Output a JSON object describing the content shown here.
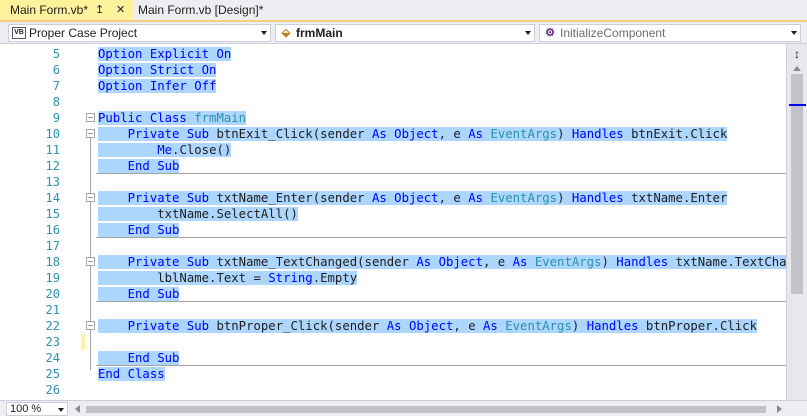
{
  "tabs": [
    {
      "label": "Main Form.vb*",
      "pin_icon": "pin-icon",
      "close_icon": "close-icon",
      "active": true
    },
    {
      "label": "Main Form.vb [Design]*",
      "active": false
    }
  ],
  "navbar": {
    "project": "Proper Case Project",
    "project_icon_text": "VB",
    "class": "frmMain",
    "member": "InitializeComponent"
  },
  "editor": {
    "lines": [
      {
        "num": "5",
        "parts": [
          [
            "kw",
            "Option Explicit On"
          ]
        ]
      },
      {
        "num": "6",
        "parts": [
          [
            "kw",
            "Option Strict On"
          ]
        ]
      },
      {
        "num": "7",
        "parts": [
          [
            "kw",
            "Option Infer Off"
          ]
        ]
      },
      {
        "num": "8",
        "parts": []
      },
      {
        "num": "9",
        "parts": [
          [
            "kw",
            "Public Class "
          ],
          [
            "ty",
            "frmMain"
          ]
        ]
      },
      {
        "num": "10",
        "parts": [
          [
            "tx",
            "    "
          ],
          [
            "kw",
            "Private Sub "
          ],
          [
            "tx",
            "btnExit_Click(sender "
          ],
          [
            "kw",
            "As Object"
          ],
          [
            "tx",
            ", e "
          ],
          [
            "kw",
            "As "
          ],
          [
            "ty",
            "EventArgs"
          ],
          [
            "tx",
            ") "
          ],
          [
            "kw",
            "Handles "
          ],
          [
            "tx",
            "btnExit.Click"
          ]
        ]
      },
      {
        "num": "11",
        "parts": [
          [
            "tx",
            "        "
          ],
          [
            "kw",
            "Me"
          ],
          [
            "tx",
            ".Close()"
          ]
        ]
      },
      {
        "num": "12",
        "parts": [
          [
            "tx",
            "    "
          ],
          [
            "kw",
            "End Sub"
          ]
        ]
      },
      {
        "num": "13",
        "parts": []
      },
      {
        "num": "14",
        "parts": [
          [
            "tx",
            "    "
          ],
          [
            "kw",
            "Private Sub "
          ],
          [
            "tx",
            "txtName_Enter(sender "
          ],
          [
            "kw",
            "As Object"
          ],
          [
            "tx",
            ", e "
          ],
          [
            "kw",
            "As "
          ],
          [
            "ty",
            "EventArgs"
          ],
          [
            "tx",
            ") "
          ],
          [
            "kw",
            "Handles "
          ],
          [
            "tx",
            "txtName.Enter"
          ]
        ]
      },
      {
        "num": "15",
        "parts": [
          [
            "tx",
            "        txtName.SelectAll()"
          ]
        ]
      },
      {
        "num": "16",
        "parts": [
          [
            "tx",
            "    "
          ],
          [
            "kw",
            "End Sub"
          ]
        ]
      },
      {
        "num": "17",
        "parts": []
      },
      {
        "num": "18",
        "parts": [
          [
            "tx",
            "    "
          ],
          [
            "kw",
            "Private Sub "
          ],
          [
            "tx",
            "txtName_TextChanged(sender "
          ],
          [
            "kw",
            "As Object"
          ],
          [
            "tx",
            ", e "
          ],
          [
            "kw",
            "As "
          ],
          [
            "ty",
            "EventArgs"
          ],
          [
            "tx",
            ") "
          ],
          [
            "kw",
            "Handles "
          ],
          [
            "tx",
            "txtName.TextChanged"
          ]
        ]
      },
      {
        "num": "19",
        "parts": [
          [
            "tx",
            "        lblName.Text = "
          ],
          [
            "kw",
            "String"
          ],
          [
            "tx",
            ".Empty"
          ]
        ]
      },
      {
        "num": "20",
        "parts": [
          [
            "tx",
            "    "
          ],
          [
            "kw",
            "End Sub"
          ]
        ]
      },
      {
        "num": "21",
        "parts": []
      },
      {
        "num": "22",
        "parts": [
          [
            "tx",
            "    "
          ],
          [
            "kw",
            "Private Sub "
          ],
          [
            "tx",
            "btnProper_Click(sender "
          ],
          [
            "kw",
            "As Object"
          ],
          [
            "tx",
            ", e "
          ],
          [
            "kw",
            "As "
          ],
          [
            "ty",
            "EventArgs"
          ],
          [
            "tx",
            ") "
          ],
          [
            "kw",
            "Handles "
          ],
          [
            "tx",
            "btnProper.Click"
          ]
        ]
      },
      {
        "num": "23",
        "parts": []
      },
      {
        "num": "24",
        "parts": [
          [
            "tx",
            "    "
          ],
          [
            "kw",
            "End Sub"
          ]
        ]
      },
      {
        "num": "25",
        "parts": [
          [
            "kw",
            "End Class"
          ]
        ]
      },
      {
        "num": "26",
        "parts": []
      }
    ],
    "colors": {
      "keyword": "#0000ff",
      "type": "#2b91af",
      "selection": "#add6ff",
      "linenum": "#2b91af"
    }
  },
  "zoom": {
    "value": "100 %"
  }
}
